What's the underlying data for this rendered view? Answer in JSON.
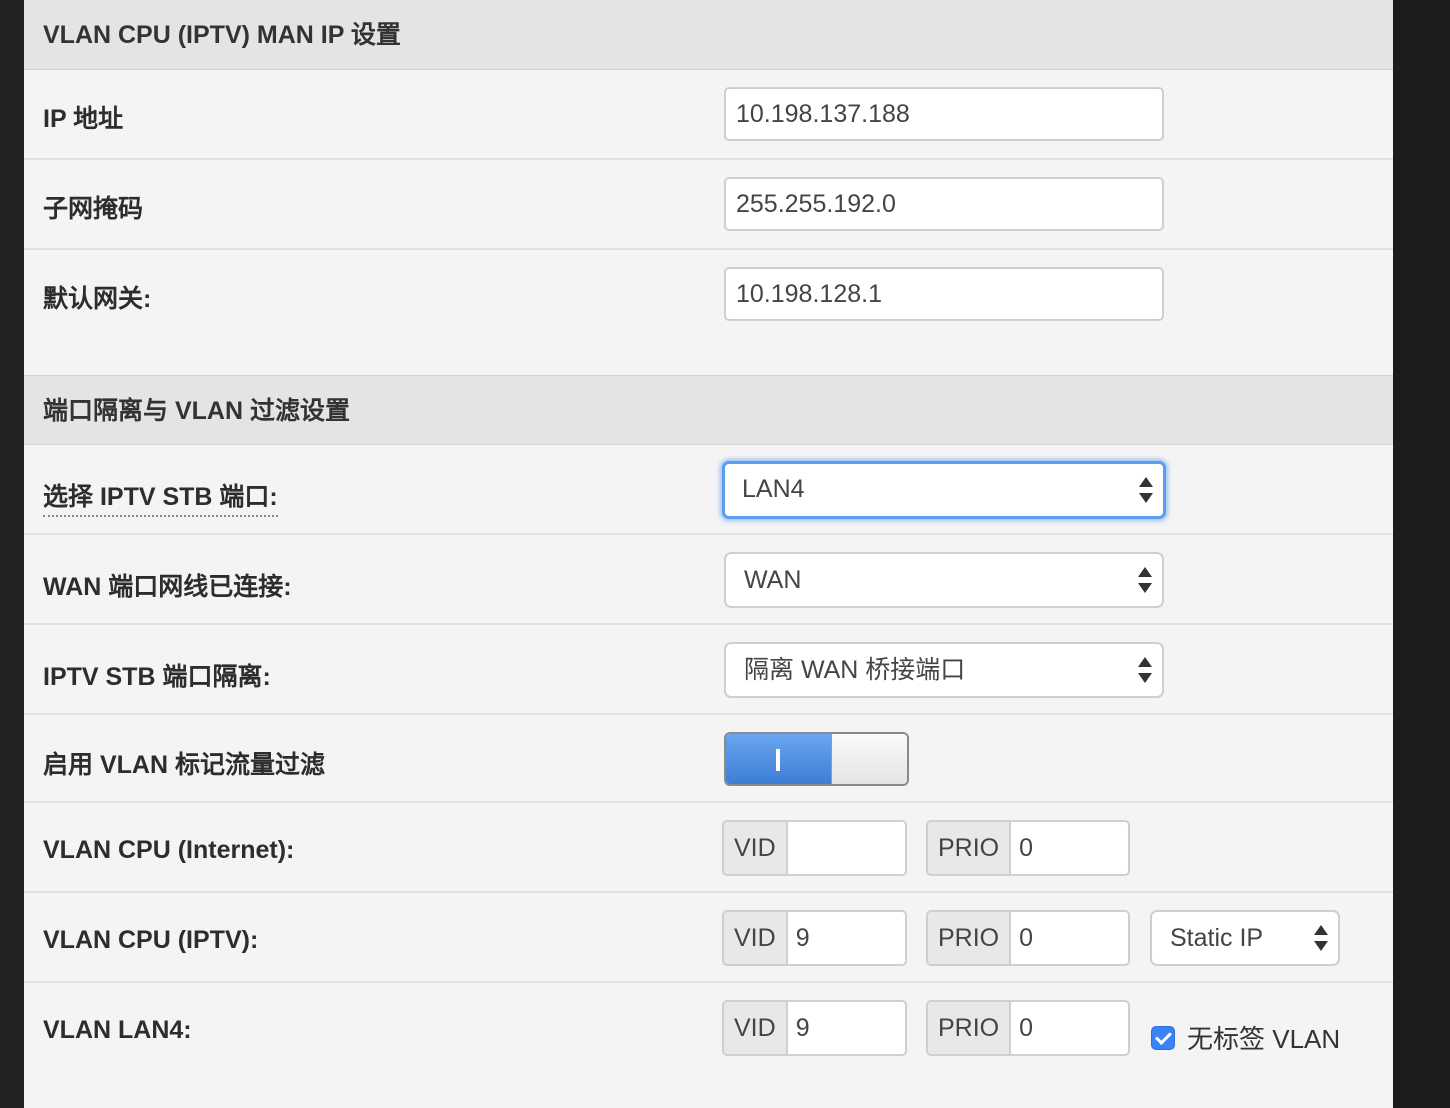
{
  "man_ip": {
    "header": "VLAN CPU (IPTV) MAN IP 设置",
    "ip_label": "IP 地址",
    "ip_value": "10.198.137.188",
    "mask_label": "子网掩码",
    "mask_value": "255.255.192.0",
    "gateway_label": "默认网关:",
    "gateway_value": "10.198.128.1"
  },
  "port_isolation": {
    "header": "端口隔离与 VLAN 过滤设置",
    "stb_port_label": "选择 IPTV STB 端口:",
    "stb_port_value": "LAN4",
    "wan_port_label": "WAN 端口网线已连接:",
    "wan_port_value": "WAN",
    "stb_isolation_label": "IPTV STB 端口隔离:",
    "stb_isolation_value": "隔离 WAN 桥接端口",
    "vlan_filter_label": "启用 VLAN 标记流量过滤",
    "vlan_filter_enabled": true,
    "vlan_cpu_internet": {
      "label": "VLAN CPU (Internet):",
      "vid_label": "VID",
      "vid_value": "",
      "prio_label": "PRIO",
      "prio_value": "0"
    },
    "vlan_cpu_iptv": {
      "label": "VLAN CPU (IPTV):",
      "vid_label": "VID",
      "vid_value": "9",
      "prio_label": "PRIO",
      "prio_value": "0",
      "mode_value": "Static IP"
    },
    "vlan_lan4": {
      "label": "VLAN LAN4:",
      "vid_label": "VID",
      "vid_value": "9",
      "prio_label": "PRIO",
      "prio_value": "0",
      "untagged_label": "无标签 VLAN",
      "untagged_checked": true
    }
  },
  "colors": {
    "accent": "#3b82f6",
    "focus_ring": "#5b9ef0",
    "panel_bg": "#f4f4f4",
    "header_bg": "#e4e4e4"
  }
}
